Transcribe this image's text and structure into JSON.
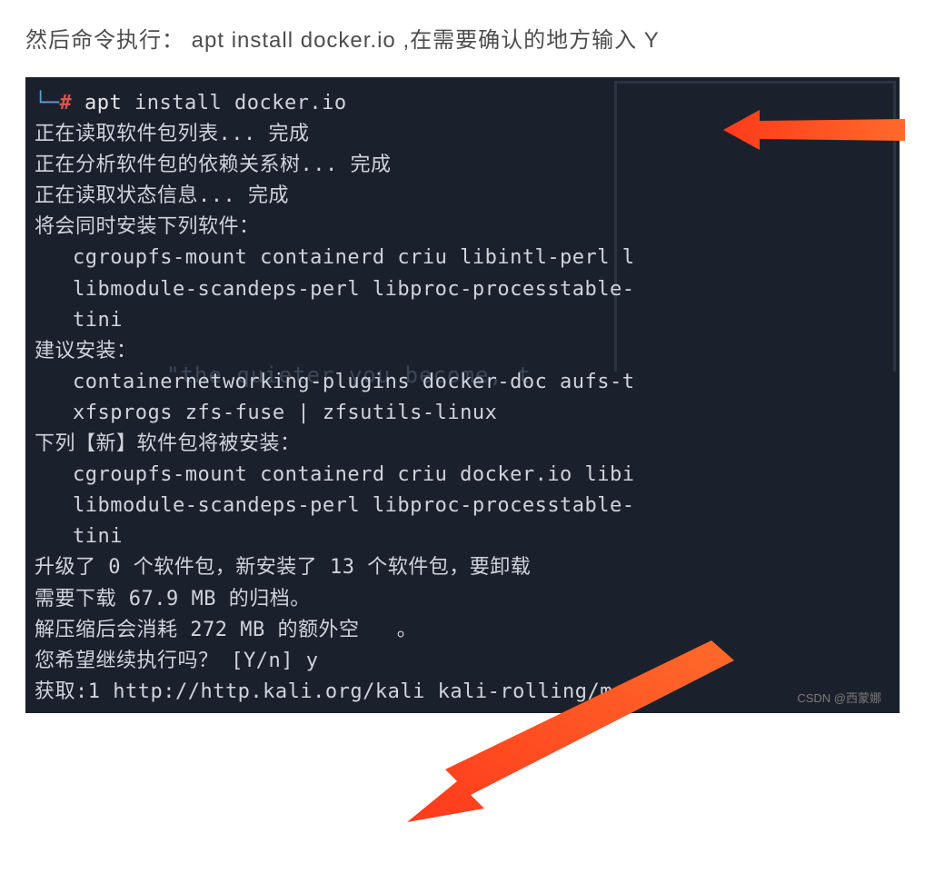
{
  "instruction": "然后命令执行：  apt install docker.io ,在需要确认的地方输入 Y",
  "terminal": {
    "prompt_branch": "└─",
    "prompt_hash": "#",
    "cmd_name": "apt",
    "cmd_args": "install docker.io",
    "lines": {
      "l1": "正在读取软件包列表... 完成",
      "l2": "正在分析软件包的依赖关系树... 完成",
      "l3": "正在读取状态信息... 完成",
      "l4": "将会同时安装下列软件：",
      "l5": "cgroupfs-mount containerd criu libintl-perl l",
      "l6": "libmodule-scandeps-perl libproc-processtable-",
      "l7": "tini",
      "l8": "建议安装：",
      "l9": "containernetworking-plugins docker-doc aufs-t",
      "l10": "xfsprogs zfs-fuse | zfsutils-linux",
      "l11": "下列【新】软件包将被安装：",
      "l12": "cgroupfs-mount containerd criu docker.io libi",
      "l13": "libmodule-scandeps-perl libproc-processtable-",
      "l14": "tini",
      "l15": "升级了 0 个软件包，新安装了 13 个软件包，要卸载",
      "l16": "需要下载 67.9 MB 的归档。",
      "l17": "解压缩后会消耗 272 MB 的额外空   。",
      "l18": "您希望继续执行吗？ [Y/n] y",
      "l19": "获取:1 http://http.kali.org/kali kali-rolling/m"
    },
    "bg_tagline": "\"the quieter you become, t"
  },
  "watermark": "CSDN @西蒙娜"
}
